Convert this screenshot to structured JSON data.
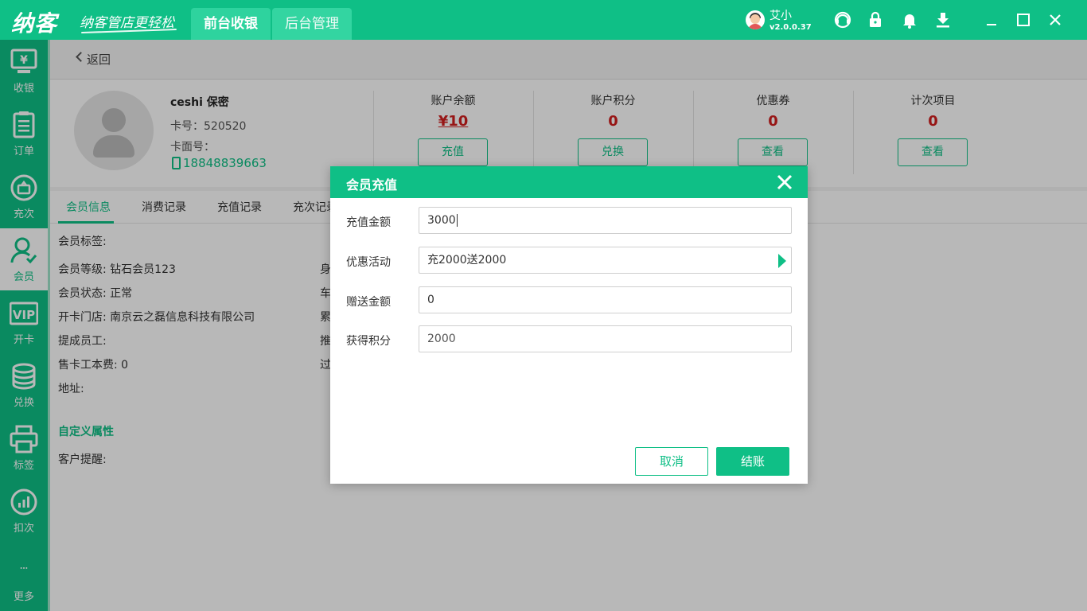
{
  "app": {
    "logo": "纳客",
    "slogan": "纳客管店更轻松",
    "tabs": [
      {
        "label": "前台收银"
      },
      {
        "label": "后台管理"
      }
    ],
    "user": {
      "name": "艾小",
      "version": "v2.0.0.37"
    },
    "colors": {
      "brand": "#0fbf86",
      "value_red": "#d11f1f"
    }
  },
  "sidebar": {
    "items": [
      {
        "label": "收银",
        "icon": "cashier-icon"
      },
      {
        "label": "订单",
        "icon": "order-icon"
      },
      {
        "label": "充次",
        "icon": "recharge-times-icon"
      },
      {
        "label": "会员",
        "icon": "member-icon"
      },
      {
        "label": "开卡",
        "icon": "vip-card-icon"
      },
      {
        "label": "兑换",
        "icon": "exchange-icon"
      },
      {
        "label": "标签",
        "icon": "print-label-icon"
      },
      {
        "label": "扣次",
        "icon": "deduct-times-icon"
      },
      {
        "label": "更多",
        "icon": "more-icon"
      }
    ]
  },
  "page": {
    "back_label": "返回",
    "member": {
      "name": "ceshi 保密",
      "card_no": "卡号：520520",
      "card_face": "卡面号：",
      "phone": "18848839663"
    },
    "stats": [
      {
        "label": "账户余额",
        "value": "¥10",
        "button": "充值"
      },
      {
        "label": "账户积分",
        "value": "0",
        "button": "兑换"
      },
      {
        "label": "优惠券",
        "value": "0",
        "button": "查看"
      },
      {
        "label": "计次项目",
        "value": "0",
        "button": "查看"
      }
    ],
    "tabs": [
      {
        "label": "会员信息"
      },
      {
        "label": "消费记录"
      },
      {
        "label": "充值记录"
      },
      {
        "label": "充次记录"
      }
    ],
    "info": {
      "tag": "会员标签:",
      "level": "会员等级:  钻石会员123",
      "status": "会员状态:  正常",
      "store": "开卡门店:  南京云之磊信息科技有限公司",
      "staff": "提成员工:",
      "fee": "售卡工本费:  0",
      "address": "地址:",
      "right_1": "身",
      "right_2": "车",
      "right_3": "累",
      "right_4": "推",
      "right_5": "过",
      "custom_title": "自定义属性",
      "reminder": "客户提醒:"
    }
  },
  "modal": {
    "title": "会员充值",
    "fields": [
      {
        "label": "充值金额",
        "value": "3000"
      },
      {
        "label": "优惠活动",
        "value": "充2000送2000"
      },
      {
        "label": "赠送金额",
        "value": "0"
      },
      {
        "label": "获得积分",
        "value": "2000"
      }
    ],
    "cancel_label": "取消",
    "ok_label": "结账"
  }
}
